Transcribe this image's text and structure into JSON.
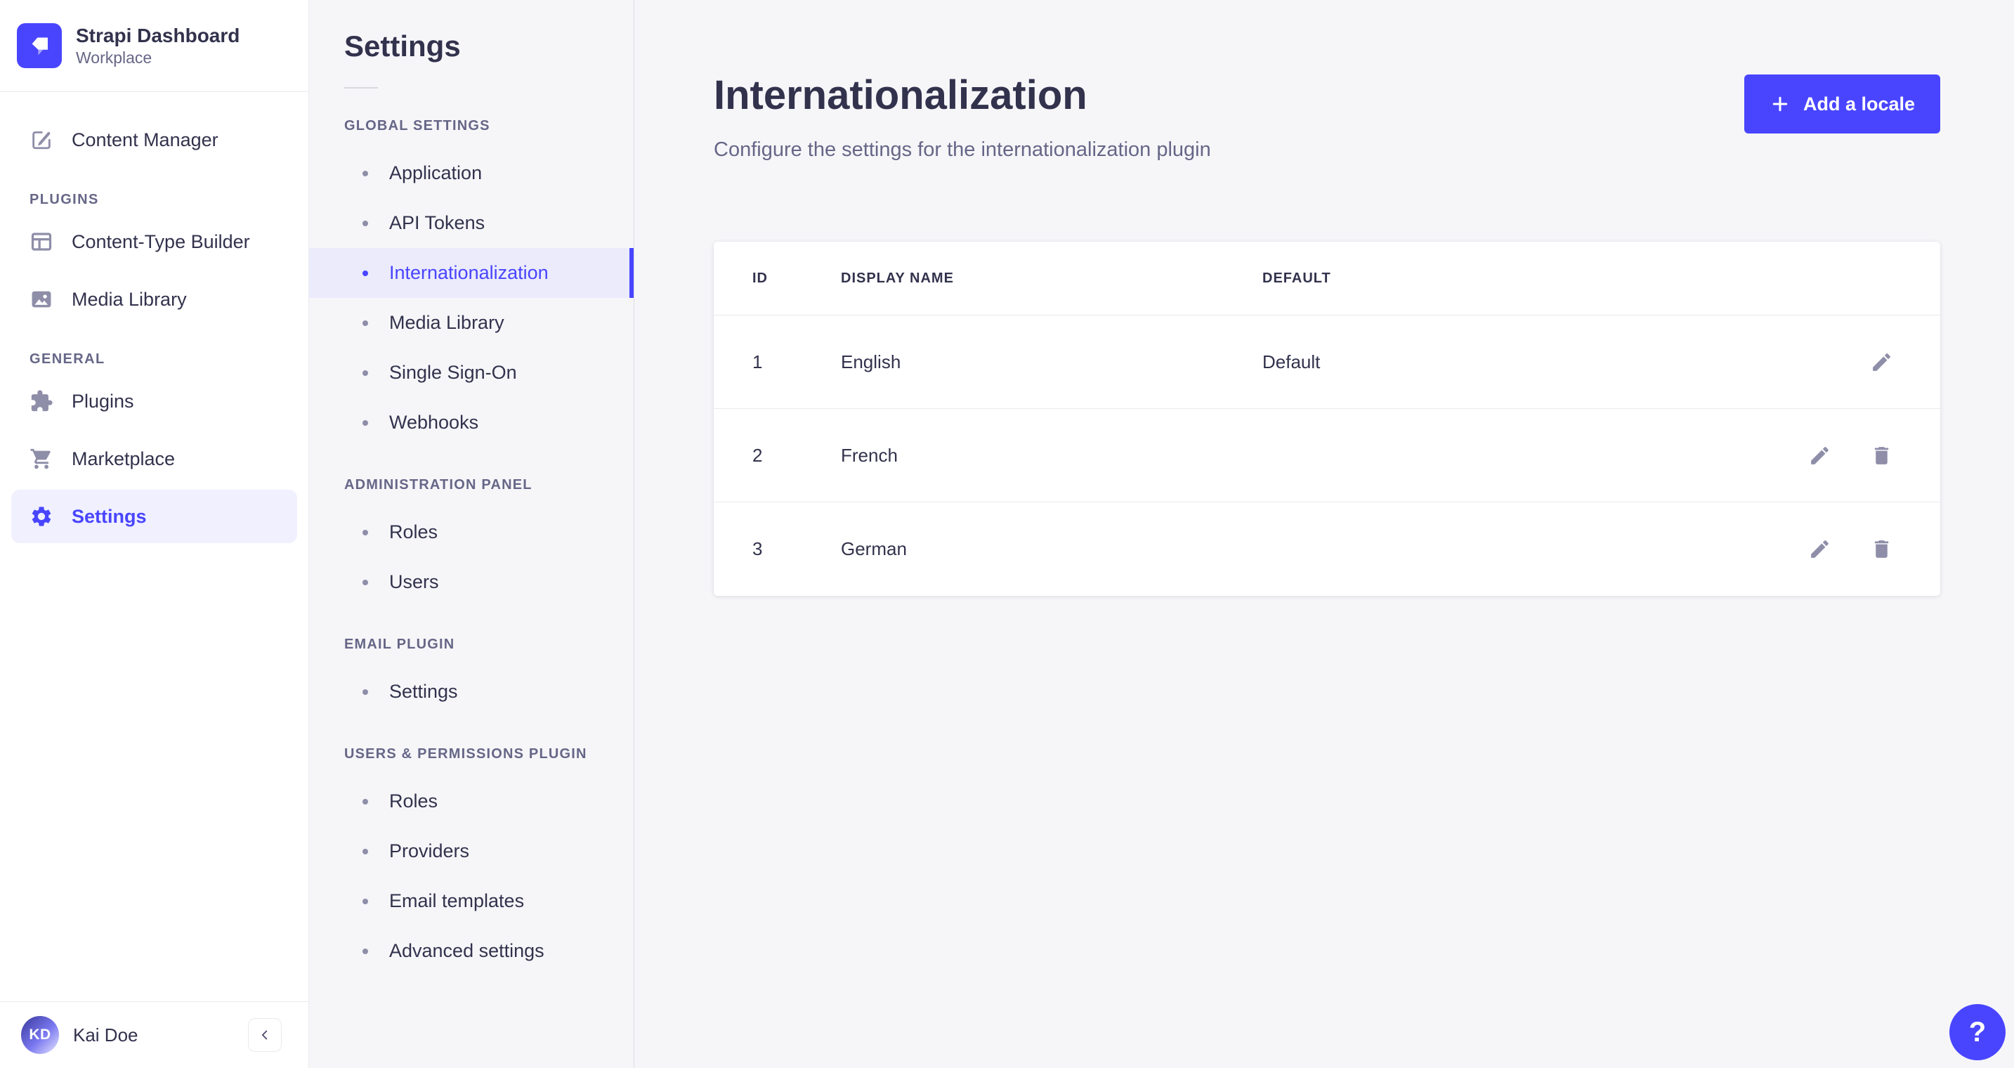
{
  "colors": {
    "primary": "#4945ff",
    "primary_light_bg": "#f0f0ff",
    "active_band_bg": "#ebebfc",
    "text_dark": "#32324d",
    "text_muted": "#666687",
    "icon_gray": "#8e8ea9",
    "surface": "#ffffff",
    "app_bg": "#f6f6f9",
    "border": "#eaeaef"
  },
  "brand": {
    "name": "Strapi Dashboard",
    "workspace": "Workplace"
  },
  "sidebar": {
    "top_item": {
      "label": "Content Manager"
    },
    "sections": [
      {
        "label": "PLUGINS",
        "items": [
          {
            "label": "Content-Type Builder"
          },
          {
            "label": "Media Library"
          }
        ]
      },
      {
        "label": "GENERAL",
        "items": [
          {
            "label": "Plugins"
          },
          {
            "label": "Marketplace"
          },
          {
            "label": "Settings"
          }
        ]
      }
    ],
    "active_item": "Settings",
    "footer": {
      "user_initials": "KD",
      "user_name": "Kai Doe"
    }
  },
  "subnav": {
    "title": "Settings",
    "active_item": "Internationalization",
    "sections": [
      {
        "label": "GLOBAL SETTINGS",
        "items": [
          "Application",
          "API Tokens",
          "Internationalization",
          "Media Library",
          "Single Sign-On",
          "Webhooks"
        ]
      },
      {
        "label": "ADMINISTRATION PANEL",
        "items": [
          "Roles",
          "Users"
        ]
      },
      {
        "label": "EMAIL PLUGIN",
        "items": [
          "Settings"
        ]
      },
      {
        "label": "USERS & PERMISSIONS PLUGIN",
        "items": [
          "Roles",
          "Providers",
          "Email templates",
          "Advanced settings"
        ]
      }
    ]
  },
  "main": {
    "title": "Internationalization",
    "subtitle": "Configure the settings for the internationalization plugin",
    "add_button_label": "Add a locale",
    "table": {
      "headers": [
        "ID",
        "DISPLAY NAME",
        "DEFAULT"
      ],
      "rows": [
        {
          "id": "1",
          "display_name": "English",
          "default": "Default"
        },
        {
          "id": "2",
          "display_name": "French",
          "default": ""
        },
        {
          "id": "3",
          "display_name": "German",
          "default": ""
        }
      ]
    }
  },
  "help": {
    "label": "?"
  }
}
